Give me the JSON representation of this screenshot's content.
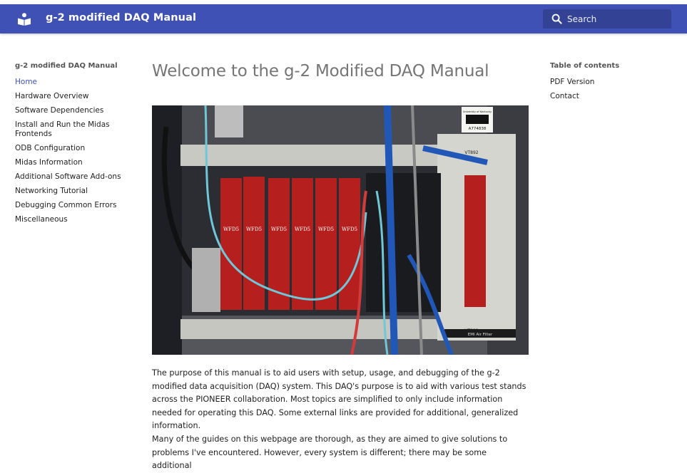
{
  "header": {
    "site_title": "g-2 modified DAQ Manual",
    "search_placeholder": "Search",
    "logo_icon": "book-reader-icon",
    "color": "#3f51b5"
  },
  "nav": {
    "title": "g-2 modified DAQ Manual",
    "items": [
      {
        "label": "Home",
        "active": true
      },
      {
        "label": "Hardware Overview"
      },
      {
        "label": "Software Dependencies"
      },
      {
        "label": "Install and Run the Midas Frontends"
      },
      {
        "label": "ODB Configuration"
      },
      {
        "label": "Midas Information"
      },
      {
        "label": "Additional Software Add-ons"
      },
      {
        "label": "Networking Tutorial"
      },
      {
        "label": "Debugging Common Errors"
      },
      {
        "label": "Miscellaneous"
      }
    ]
  },
  "toc": {
    "title": "Table of contents",
    "items": [
      {
        "label": "PDF Version"
      },
      {
        "label": "Contact"
      }
    ]
  },
  "main": {
    "title": "Welcome to the g-2 Modified DAQ Manual",
    "photo": {
      "card_label": "WFD5",
      "crate_label": "VT892",
      "asset_tag": "A774838",
      "asset_owner": "University of Kentucky",
      "filter_label": "EMI Air Filter"
    },
    "paragraphs": [
      "The purpose of this manual is to aid users with setup, usage, and debugging of the g-2 modified data acquisition (DAQ) system. This DAQ's purpose is to aid with various test stands across the PIONEER collaboration. Most topics are simplified to only include information needed for operating this DAQ. Some external links are provided for additional, generalized information.",
      "Many of the guides on this webpage are thorough, as they are aimed to give solutions to problems I've encountered. However, every system is different; there may be some additional"
    ]
  }
}
